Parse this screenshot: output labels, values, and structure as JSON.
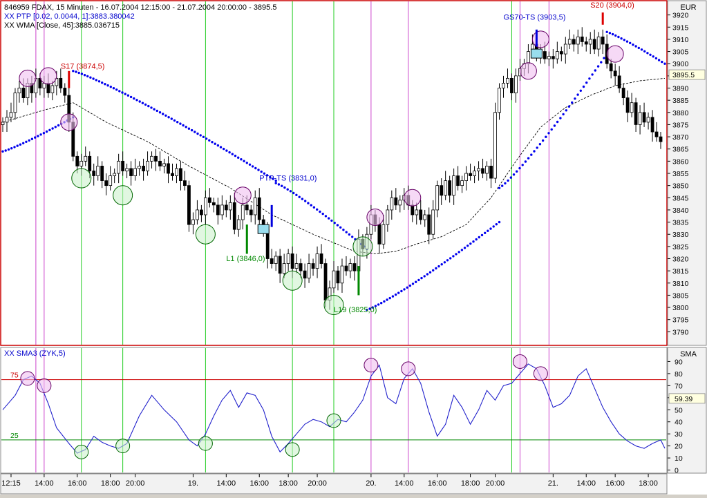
{
  "header": {
    "line1": "846959  FDAX, 15 Minuten - 16.07.2004 12:15:00 - 21.07.2004 20:00:00 - 3895.5",
    "line2": "XX PTP [0.02, 0.0044, 1]:3883.380042",
    "line3": "XX WMA [Close, 45]:3885.036715"
  },
  "currency_label": "EUR",
  "sub_label": "XX   SMA3 (ZYK,5)",
  "sub_axis_label": "SMA",
  "colors": {
    "background": "#ffffff",
    "frame": "#cc0000",
    "candle": "#000000",
    "psar": "#0000ee",
    "wma": "#000000",
    "sma": "#2222cc",
    "green_vline": "#22cc22",
    "magenta_vline": "#cc44cc",
    "circle_green": "#c8f0c8",
    "circle_pink": "#f0c0f0",
    "level_75": "#cc0000",
    "level_25": "#008800"
  },
  "chart_data": [
    {
      "type": "candlestick",
      "title": "846959  FDAX, 15 Minuten - 16.07.2004 12:15:00 - 21.07.2004 20:00:00 - 3895.5",
      "ylabel": "EUR",
      "ylim": [
        3785,
        3925
      ],
      "yticks": [
        3790,
        3795,
        3800,
        3805,
        3810,
        3815,
        3820,
        3825,
        3830,
        3835,
        3840,
        3845,
        3850,
        3855,
        3860,
        3865,
        3870,
        3875,
        3880,
        3885,
        3890,
        3895,
        3900,
        3905,
        3910,
        3915,
        3920
      ],
      "last_value": "3895.5",
      "x_range": [
        0,
        160
      ],
      "xticks": [
        {
          "i": 2,
          "label": "12:15"
        },
        {
          "i": 10,
          "label": "14:00"
        },
        {
          "i": 18,
          "label": "16:00"
        },
        {
          "i": 26,
          "label": "18:00"
        },
        {
          "i": 32,
          "label": "20:00"
        },
        {
          "i": 46,
          "label": "19."
        },
        {
          "i": 54,
          "label": "14:00"
        },
        {
          "i": 62,
          "label": "16:00"
        },
        {
          "i": 69,
          "label": "18:00"
        },
        {
          "i": 76,
          "label": "20:00"
        },
        {
          "i": 89,
          "label": "20."
        },
        {
          "i": 97,
          "label": "14:00"
        },
        {
          "i": 105,
          "label": "16:00"
        },
        {
          "i": 113,
          "label": "18:00"
        },
        {
          "i": 119,
          "label": "20:00"
        },
        {
          "i": 133,
          "label": "21."
        },
        {
          "i": 141,
          "label": "14:00"
        },
        {
          "i": 148,
          "label": "16:00"
        },
        {
          "i": 156,
          "label": "18:00"
        }
      ],
      "close": [
        3876,
        3878,
        3880,
        3888,
        3890,
        3886,
        3892,
        3888,
        3894,
        3890,
        3892,
        3888,
        3891,
        3894,
        3890,
        3887,
        3876,
        3862,
        3858,
        3860,
        3862,
        3856,
        3854,
        3858,
        3852,
        3850,
        3854,
        3855,
        3860,
        3856,
        3857,
        3854,
        3857,
        3858,
        3856,
        3860,
        3862,
        3860,
        3858,
        3859,
        3855,
        3854,
        3857,
        3852,
        3850,
        3834,
        3836,
        3840,
        3838,
        3845,
        3843,
        3842,
        3838,
        3842,
        3840,
        3843,
        3832,
        3836,
        3842,
        3840,
        3838,
        3845,
        3836,
        3832,
        3820,
        3818,
        3821,
        3814,
        3818,
        3822,
        3816,
        3818,
        3815,
        3812,
        3818,
        3816,
        3822,
        3818,
        3803,
        3808,
        3815,
        3810,
        3817,
        3815,
        3818,
        3815,
        3828,
        3824,
        3830,
        3838,
        3834,
        3826,
        3834,
        3840,
        3845,
        3842,
        3844,
        3846,
        3842,
        3838,
        3840,
        3836,
        3838,
        3830,
        3840,
        3850,
        3846,
        3852,
        3846,
        3854,
        3850,
        3852,
        3855,
        3854,
        3856,
        3857,
        3855,
        3858,
        3853,
        3880,
        3890,
        3892,
        3894,
        3888,
        3895,
        3898,
        3900,
        3905,
        3908,
        3904,
        3905,
        3902,
        3903,
        3902,
        3905,
        3904,
        3908,
        3910,
        3908,
        3911,
        3909,
        3908,
        3910,
        3906,
        3911,
        3908,
        3900,
        3897,
        3895,
        3890,
        3886,
        3880,
        3884,
        3875,
        3880,
        3876,
        3878,
        3872,
        3870,
        3868
      ],
      "ohlc_note": "open ≈ previous close; high/low estimated as ±3 from body",
      "wma": [
        [
          0,
          3876
        ],
        [
          10,
          3881
        ],
        [
          17,
          3884
        ],
        [
          25,
          3876
        ],
        [
          35,
          3868
        ],
        [
          45,
          3858
        ],
        [
          55,
          3849
        ],
        [
          65,
          3838
        ],
        [
          75,
          3830
        ],
        [
          85,
          3823
        ],
        [
          90,
          3822
        ],
        [
          95,
          3823
        ],
        [
          100,
          3826
        ],
        [
          106,
          3829
        ],
        [
          112,
          3834
        ],
        [
          118,
          3845
        ],
        [
          124,
          3860
        ],
        [
          130,
          3874
        ],
        [
          136,
          3882
        ],
        [
          142,
          3887
        ],
        [
          148,
          3891
        ],
        [
          154,
          3893
        ],
        [
          160,
          3894
        ]
      ],
      "psar": [
        {
          "x": [
            0,
            17
          ],
          "y": [
            3864,
            3878
          ]
        },
        {
          "x": [
            17,
            66
          ],
          "y": [
            3897,
            3852
          ]
        },
        {
          "x": [
            66,
            88
          ],
          "y": [
            3851,
            3824
          ]
        },
        {
          "x": [
            88,
            120
          ],
          "y": [
            3799,
            3835
          ]
        },
        {
          "x": [
            120,
            146
          ],
          "y": [
            3849,
            3904
          ]
        },
        {
          "x": [
            146,
            160
          ],
          "y": [
            3913,
            3900
          ]
        }
      ],
      "vlines_green": [
        19,
        29,
        49,
        70,
        80,
        123
      ],
      "vlines_magenta": [
        8,
        10,
        89,
        98,
        125,
        132
      ],
      "markers_green_circle": [
        [
          19,
          3853
        ],
        [
          29,
          3846
        ],
        [
          49,
          3830
        ],
        [
          70,
          3811
        ],
        [
          80,
          3801
        ],
        [
          87,
          3825
        ]
      ],
      "markers_pink_circle": [
        [
          6,
          3894
        ],
        [
          11,
          3895
        ],
        [
          16,
          3876
        ],
        [
          58,
          3846
        ],
        [
          90,
          3837
        ],
        [
          99,
          3845
        ],
        [
          127,
          3897
        ],
        [
          130,
          3910
        ],
        [
          148,
          3904
        ]
      ],
      "annotations": [
        {
          "text": "S17 (3874,5)",
          "x": 14,
          "y": 3898,
          "color": "#cc0000"
        },
        {
          "text": "PTP-TS (3831,0)",
          "x": 62,
          "y": 3852,
          "color": "#0000cc"
        },
        {
          "text": "L1 (3846,0)",
          "x": 54,
          "y": 3819,
          "color": "#008800"
        },
        {
          "text": "L19 (3825,0)",
          "x": 80,
          "y": 3798,
          "color": "#008800"
        },
        {
          "text": "GS70-TS (3903,5)",
          "x": 121,
          "y": 3918,
          "color": "#0000cc"
        },
        {
          "text": "S20 (3904,0)",
          "x": 142,
          "y": 3923,
          "color": "#cc0000"
        }
      ],
      "signal_bars": [
        {
          "x": 16,
          "y1": 3890,
          "y2": 3897,
          "color": "#dd0000"
        },
        {
          "x": 65,
          "y1": 3833,
          "y2": 3842,
          "color": "#0000dd"
        },
        {
          "x": 59,
          "y1": 3822,
          "y2": 3834,
          "color": "#008800"
        },
        {
          "x": 86,
          "y1": 3805,
          "y2": 3817,
          "color": "#008800"
        },
        {
          "x": 129,
          "y1": 3907,
          "y2": 3914,
          "color": "#0000dd"
        },
        {
          "x": 145,
          "y1": 3916,
          "y2": 3921,
          "color": "#dd0000"
        }
      ],
      "boxes": [
        [
          63,
          3832
        ],
        [
          129,
          3904
        ]
      ]
    },
    {
      "type": "line",
      "title": "XX   SMA3 (ZYK,5)",
      "ylabel": "SMA",
      "ylim": [
        -2,
        100
      ],
      "yticks": [
        0,
        10,
        20,
        30,
        40,
        50,
        60,
        70,
        80,
        90
      ],
      "levels": [
        {
          "value": 75,
          "label": "75"
        },
        {
          "value": 25,
          "label": "25"
        }
      ],
      "last_value": "59.39",
      "series": [
        {
          "x": [
            0,
            3,
            5,
            7,
            9,
            11,
            13,
            16,
            18,
            20,
            22,
            24,
            26,
            28,
            30,
            33,
            36,
            39,
            42,
            45,
            47,
            49,
            51,
            53,
            55,
            57,
            59,
            61,
            63,
            65,
            67,
            69,
            71,
            73,
            75,
            77,
            79,
            81,
            83,
            85,
            87,
            89,
            91,
            93,
            95,
            97,
            99,
            101,
            103,
            105,
            107,
            109,
            111,
            113,
            115,
            117,
            119,
            121,
            123,
            125,
            127,
            129,
            131,
            133,
            135,
            137,
            139,
            141,
            143,
            145,
            147,
            149,
            151,
            153,
            155,
            157,
            159,
            160
          ],
          "y": [
            50,
            62,
            75,
            78,
            72,
            55,
            35,
            22,
            14,
            17,
            28,
            23,
            20,
            18,
            22,
            45,
            62,
            50,
            40,
            25,
            20,
            30,
            45,
            58,
            66,
            52,
            64,
            62,
            50,
            28,
            15,
            22,
            30,
            38,
            42,
            40,
            36,
            42,
            40,
            48,
            58,
            78,
            87,
            60,
            55,
            76,
            84,
            72,
            48,
            28,
            38,
            62,
            52,
            38,
            50,
            66,
            58,
            70,
            72,
            80,
            88,
            84,
            70,
            52,
            55,
            62,
            78,
            84,
            68,
            52,
            40,
            30,
            24,
            20,
            18,
            22,
            25,
            18
          ]
        }
      ],
      "markers_green_circle": [
        [
          19,
          15
        ],
        [
          29,
          20
        ],
        [
          49,
          22
        ],
        [
          70,
          17
        ],
        [
          80,
          41
        ]
      ],
      "markers_pink_circle": [
        [
          6,
          76
        ],
        [
          10,
          70
        ],
        [
          89,
          87
        ],
        [
          98,
          84
        ],
        [
          125,
          90
        ],
        [
          130,
          80
        ]
      ],
      "vlines_green": [
        19,
        29,
        49,
        70,
        80,
        123
      ],
      "vlines_magenta": [
        8,
        10,
        89,
        98,
        125,
        132
      ]
    }
  ]
}
